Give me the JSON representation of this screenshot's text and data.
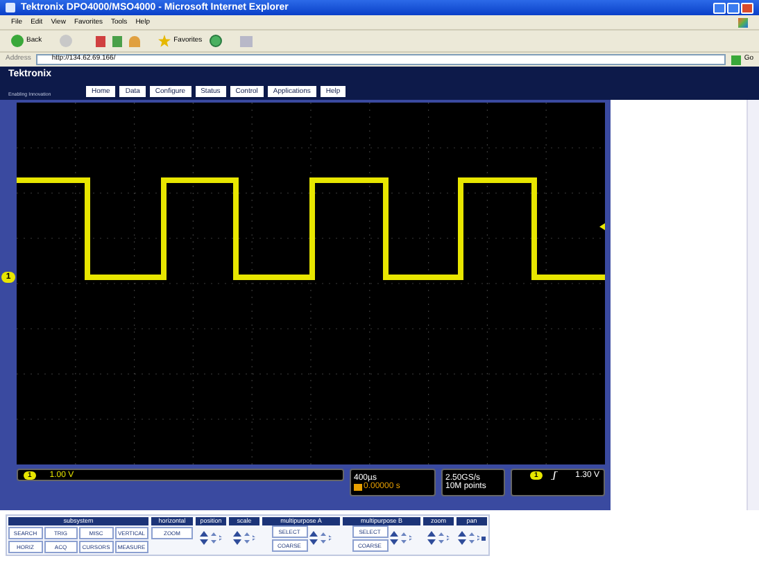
{
  "window": {
    "title": "Tektronix DPO4000/MSO4000 - Microsoft Internet Explorer"
  },
  "menu": [
    "File",
    "Edit",
    "View",
    "Favorites",
    "Tools",
    "Help"
  ],
  "toolbar": {
    "back": "Back",
    "favorites": "Favorites"
  },
  "address": {
    "label": "Address",
    "value": "http://134.62.69.166/",
    "go": "Go"
  },
  "header": {
    "brand": "Tektronix",
    "tagline": "Enabling Innovation",
    "nav": [
      {
        "label": "Home",
        "selected": false
      },
      {
        "label": "Data",
        "selected": false
      },
      {
        "label": "Configure",
        "selected": false
      },
      {
        "label": "Status",
        "selected": false
      },
      {
        "label": "Control",
        "selected": false
      },
      {
        "label": "Applications",
        "selected": false
      },
      {
        "label": "Help",
        "selected": false
      }
    ]
  },
  "scope": {
    "channel_marker": "1",
    "channel": "1",
    "channel_scale": "1.00 V",
    "timebase": "400µs",
    "delay": "0.00000 s",
    "sample_rate": "2.50GS/s",
    "record_length": "10M points",
    "trigger_source": "1",
    "trigger_level": "1.30 V"
  },
  "panel": {
    "subsystem": {
      "title": "subsystem",
      "buttons": [
        "SEARCH",
        "TRIG",
        "MISC",
        "VERTICAL",
        "HORIZ",
        "ACQ",
        "CURSORS",
        "MEASURE"
      ]
    },
    "groups": [
      {
        "kind": "button",
        "title": "horizontal",
        "buttons": [
          "ZOOM"
        ]
      },
      {
        "kind": "arrows",
        "title": "position"
      },
      {
        "kind": "arrows",
        "title": "scale"
      },
      {
        "kind": "multi",
        "title": "multipurpose A",
        "buttons": [
          "SELECT",
          "COARSE"
        ]
      },
      {
        "kind": "multi",
        "title": "multipurpose B",
        "buttons": [
          "SELECT",
          "COARSE"
        ]
      },
      {
        "kind": "arrows",
        "title": "zoom"
      },
      {
        "kind": "pan",
        "title": "pan"
      }
    ]
  }
}
